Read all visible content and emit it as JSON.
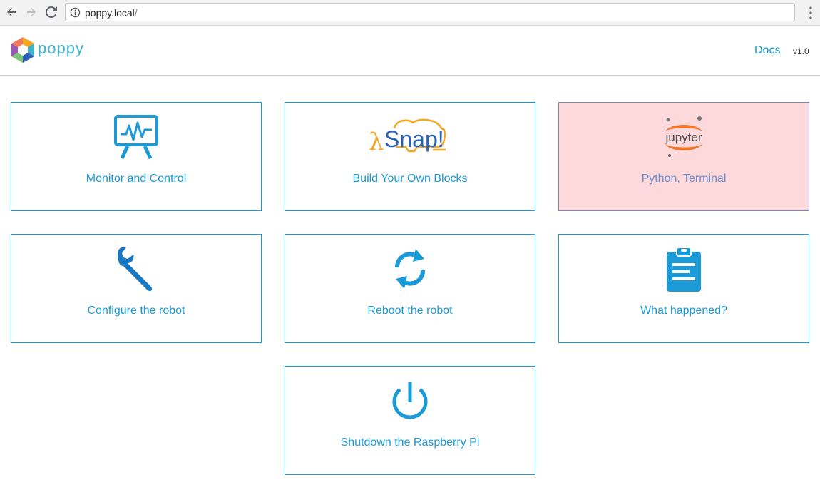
{
  "browser": {
    "url_host": "poppy.local",
    "url_path": "/",
    "back_icon": "arrow-left-icon",
    "forward_icon": "arrow-right-icon",
    "reload_icon": "reload-icon",
    "info_icon": "info-icon",
    "menu_icon": "more-vert-icon"
  },
  "header": {
    "logo_text": "poppy",
    "docs_label": "Docs",
    "version": "v1.0"
  },
  "tiles": [
    {
      "label": "Monitor and Control",
      "icon": "monitor-chart-icon"
    },
    {
      "label": "Build Your Own Blocks",
      "icon": "snap-logo"
    },
    {
      "label": "Python, Terminal",
      "icon": "jupyter-logo",
      "logo_text": "jupyter",
      "highlighted": true
    },
    {
      "label": "Configure the robot",
      "icon": "wrench-icon"
    },
    {
      "label": "Reboot the robot",
      "icon": "refresh-icon"
    },
    {
      "label": "What happened?",
      "icon": "clipboard-list-icon"
    },
    {
      "label": "Shutdown the Raspberry Pi",
      "icon": "power-icon"
    }
  ],
  "snap_logo_text": "Snap!",
  "colors": {
    "accent": "#1a9ad6",
    "highlight_bg": "#fdd9dc",
    "jupyter_orange": "#f37626",
    "snap_orange": "#f5a623",
    "snap_blue": "#2a62b8",
    "logo_teal": "#3fb3c9"
  }
}
